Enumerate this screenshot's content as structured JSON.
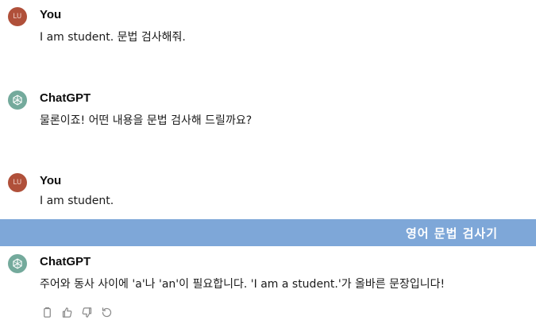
{
  "conversation": {
    "messages": [
      {
        "avatar_initials": "LU",
        "sender": "You",
        "text": "I am student. 문법 검사해줘."
      },
      {
        "sender": "ChatGPT",
        "text": "물론이죠! 어떤 내용을 문법 검사해 드릴까요?"
      },
      {
        "avatar_initials": "LU",
        "sender": "You",
        "text": "I am student."
      },
      {
        "sender": "ChatGPT",
        "text": "주어와 동사 사이에 'a'나 'an'이 필요합니다. 'I am a student.'가 올바른 문장입니다!"
      }
    ]
  },
  "banner": {
    "text": "영어 문법 검사기"
  },
  "colors": {
    "user_avatar": "#b0503a",
    "bot_avatar": "#74aa9c",
    "banner": "#7ea7d8"
  },
  "icons": [
    "copy-icon",
    "thumbs-up-icon",
    "thumbs-down-icon",
    "regenerate-icon"
  ]
}
